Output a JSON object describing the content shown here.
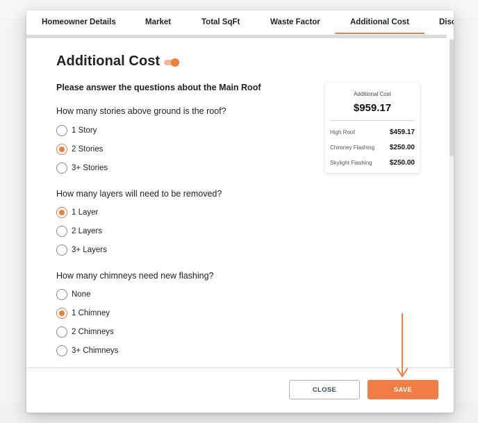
{
  "tabs": [
    {
      "label": "Homeowner Details",
      "active": false
    },
    {
      "label": "Market",
      "active": false
    },
    {
      "label": "Total SqFt",
      "active": false
    },
    {
      "label": "Waste Factor",
      "active": false
    },
    {
      "label": "Additional Cost",
      "active": true
    },
    {
      "label": "Disc",
      "active": false
    }
  ],
  "page": {
    "title": "Additional Cost",
    "toggle_on": true,
    "subtitle": "Please answer the questions about the Main Roof"
  },
  "questions": [
    {
      "text": "How many stories above ground is the roof?",
      "options": [
        "1 Story",
        "2 Stories",
        "3+ Stories"
      ],
      "selected": "2 Stories"
    },
    {
      "text": "How many layers will need to be removed?",
      "options": [
        "1 Layer",
        "2 Layers",
        "3+ Layers"
      ],
      "selected": "1 Layer"
    },
    {
      "text": "How many chimneys need new flashing?",
      "options": [
        "None",
        "1 Chimney",
        "2 Chimneys",
        "3+ Chimneys"
      ],
      "selected": "1 Chimney"
    }
  ],
  "summary": {
    "label": "Additional Cost",
    "total": "$959.17",
    "items": [
      {
        "name": "High Roof",
        "value": "$459.17"
      },
      {
        "name": "Chimney Flashing",
        "value": "$250.00"
      },
      {
        "name": "Skylight Flashing",
        "value": "$250.00"
      }
    ]
  },
  "footer": {
    "close_label": "CLOSE",
    "save_label": "SAVE"
  },
  "colors": {
    "accent": "#ef7d45",
    "accent_light": "#f4b593",
    "close_text": "#3d4b55"
  }
}
